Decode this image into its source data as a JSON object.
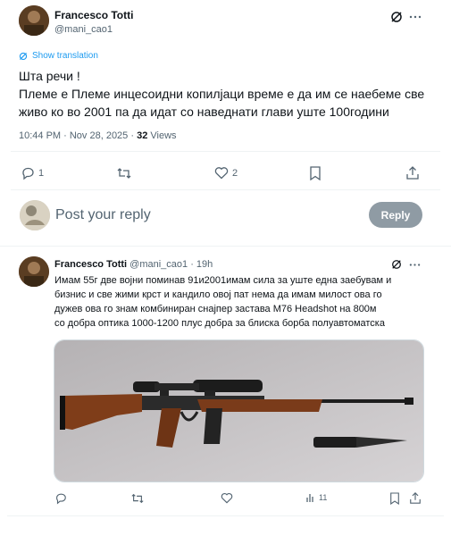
{
  "main_post": {
    "author_name": "Francesco Totti",
    "handle": "@mani_cao1",
    "show_translation": "Show translation",
    "text_line1": "Шта речи !",
    "text_line2": "Племе е Племе инцесоидни копилјаци време е да им се наебеме све",
    "text_line3": "живо  ко во 2001  па да идат со наведнати глави уште 100години",
    "timestamp": "10:44 PM · Nov 28, 2025 · ",
    "views_count": "32",
    "views_label": " Views"
  },
  "actions": {
    "reply_count": "1",
    "like_count": "2"
  },
  "composer": {
    "placeholder": "Post your reply",
    "reply_button": "Reply"
  },
  "reply_post": {
    "author_name": "Francesco Totti",
    "handle_time": "@mani_cao1 · 19h",
    "line1": "Имам 55г две војни поминав 91и2001имам сила за уште една заебувам и",
    "line2": "бизнис и све  жими крст и кандило овој пат нема да имам милост ова го",
    "line3": "дужев ова го знам  комбиниран снајпер  застава М76 Headshot на 800м",
    "line4": "со добра оптика 1000-1200 плус добра за блиска борба полуавтоматска",
    "views": "11"
  },
  "colors": {
    "accent": "#1d9bf0",
    "muted": "#536471",
    "reply_button_bg": "#8f9ba4",
    "separator": "#eff3f4"
  },
  "icons": [
    "grok-icon",
    "more-icon",
    "reply-icon",
    "repost-icon",
    "like-icon",
    "bookmark-icon",
    "share-icon",
    "views-icon"
  ]
}
